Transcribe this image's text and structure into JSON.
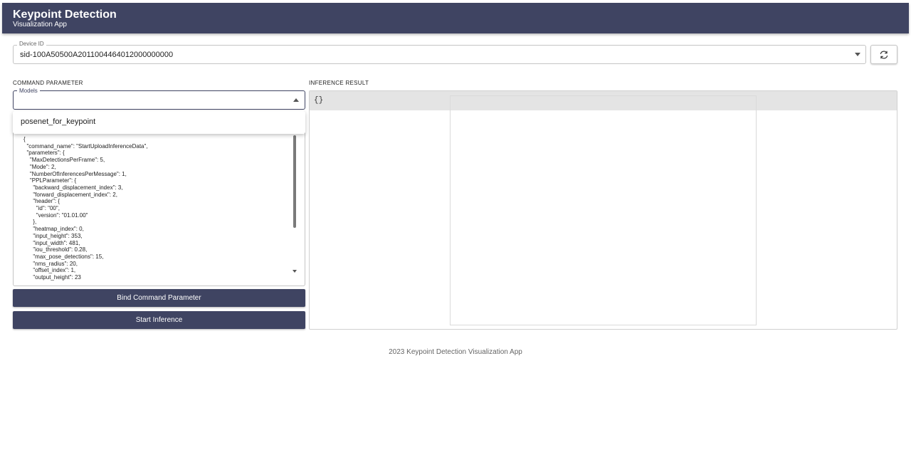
{
  "header": {
    "title": "Keypoint Detection",
    "subtitle": "Visualization App"
  },
  "device": {
    "label": "Device ID",
    "value": "sid-100A50500A2011004464012000000000",
    "refresh_icon": "refresh-icon"
  },
  "command_parameter": {
    "section_label": "COMMAND PARAMETER",
    "models_label": "Models",
    "models_value": "",
    "dropdown_options": [
      "posenet_for_keypoint"
    ],
    "json_text": "{\n  \"command_name\": \"StartUploadInferenceData\",\n  \"parameters\": {\n    \"MaxDetectionsPerFrame\": 5,\n    \"Mode\": 2,\n    \"NumberOfInferencesPerMessage\": 1,\n    \"PPLParameter\": {\n      \"backward_displacement_index\": 3,\n      \"forward_displacement_index\": 2,\n      \"header\": {\n        \"id\": \"00\",\n        \"version\": \"01.01.00\"\n      },\n      \"heatmap_index\": 0,\n      \"input_height\": 353,\n      \"input_width\": 481,\n      \"iou_threshold\": 0.28,\n      \"max_pose_detections\": 15,\n      \"nms_radius\": 20,\n      \"offset_index\": 1,\n      \"output_height\": 23"
  },
  "buttons": {
    "bind": "Bind Command Parameter",
    "start": "Start Inference"
  },
  "inference_result": {
    "section_label": "INFERENCE RESULT",
    "json_preview": "{}"
  },
  "footer": {
    "text": "2023 Keypoint Detection Visualization App"
  },
  "colors": {
    "primary": "#3f4462",
    "result_bar": "#e4e4e4"
  }
}
